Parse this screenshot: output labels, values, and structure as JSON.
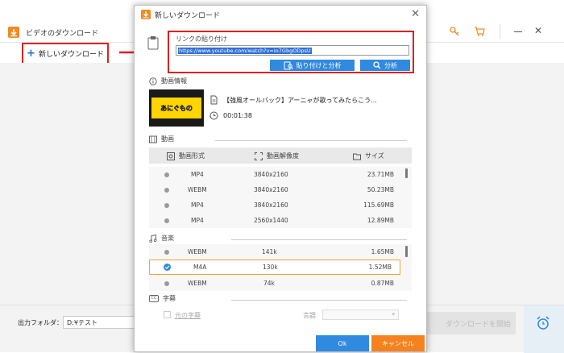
{
  "main_window": {
    "title": "ビデオのダウンロード",
    "new_download_label": "新しいダウンロード",
    "output_folder_label": "出力フォルダ：",
    "output_folder_value": "D:¥テスト",
    "start_download_label": "ダウンロードを開始"
  },
  "dialog": {
    "title": "新しいダウンロード",
    "link_label": "リンクの貼り付け",
    "url_value": "https://www.youtube.com/watch?v=Io7GbgODpsU",
    "paste_analyze_label": "貼り付けと分析",
    "analyze_label": "分析",
    "video_info_label": "動画情報",
    "video_title": "【強風オールバック】アーニャが歌ってみたらこう...",
    "video_duration": "00:01:38",
    "thumbnail_text": "あにぐもの",
    "video_section_label": "動画",
    "columns": {
      "format": "動画形式",
      "resolution": "動画解像度",
      "size": "サイズ"
    },
    "video_rows": [
      {
        "format": "MP4",
        "resolution": "3840x2160",
        "size": "23.71MB"
      },
      {
        "format": "WEBM",
        "resolution": "3840x2160",
        "size": "50.23MB"
      },
      {
        "format": "MP4",
        "resolution": "3840x2160",
        "size": "115.69MB"
      },
      {
        "format": "MP4",
        "resolution": "2560x1440",
        "size": "12.89MB"
      }
    ],
    "audio_section_label": "音楽",
    "audio_rows": [
      {
        "format": "WEBM",
        "bitrate": "141k",
        "size": "1.65MB",
        "selected": false
      },
      {
        "format": "M4A",
        "bitrate": "130k",
        "size": "1.52MB",
        "selected": true
      },
      {
        "format": "WEBM",
        "bitrate": "74k",
        "size": "0.87MB",
        "selected": false
      }
    ],
    "subtitle_section_label": "字幕",
    "original_subtitle_label": "元の字幕",
    "language_label": "言語",
    "ok_label": "Ok",
    "cancel_label": "キャンセル"
  },
  "colors": {
    "accent_blue": "#2f8ae0",
    "cancel_orange": "#f5821f",
    "highlight_red": "#e02020",
    "app_orange": "#f08a24"
  }
}
